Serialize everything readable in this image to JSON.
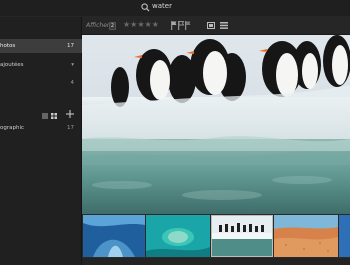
{
  "search": {
    "query": "water"
  },
  "sidebar": {
    "items": [
      {
        "label": "hotos",
        "count": "17",
        "selected": true
      },
      {
        "label": "ajoutées",
        "count": "",
        "chevron": "▾"
      },
      {
        "label": "",
        "count": "4"
      },
      {
        "label": "ographic",
        "count": "17"
      }
    ],
    "tools": [
      "list-view-icon",
      "grid-view-icon",
      "add-icon"
    ]
  },
  "toolbar": {
    "filter_label": "Afficher",
    "filter_badge": "2",
    "stars": "★★★★★",
    "flags": [
      "flag-outline-icon",
      "flag-picked-icon",
      "flag-rejected-icon"
    ],
    "view_buttons": [
      "single-view-icon",
      "grid-view-icon"
    ]
  },
  "viewer": {
    "image": "penguins-on-ice-underwater"
  },
  "filmstrip": {
    "thumbnails": [
      "ice-cave-thumbnail",
      "sea-turtle-thumbnail",
      "penguins-thumbnail",
      "desert-thumbnail",
      "blue-thumbnail"
    ],
    "selected_index": 2
  }
}
